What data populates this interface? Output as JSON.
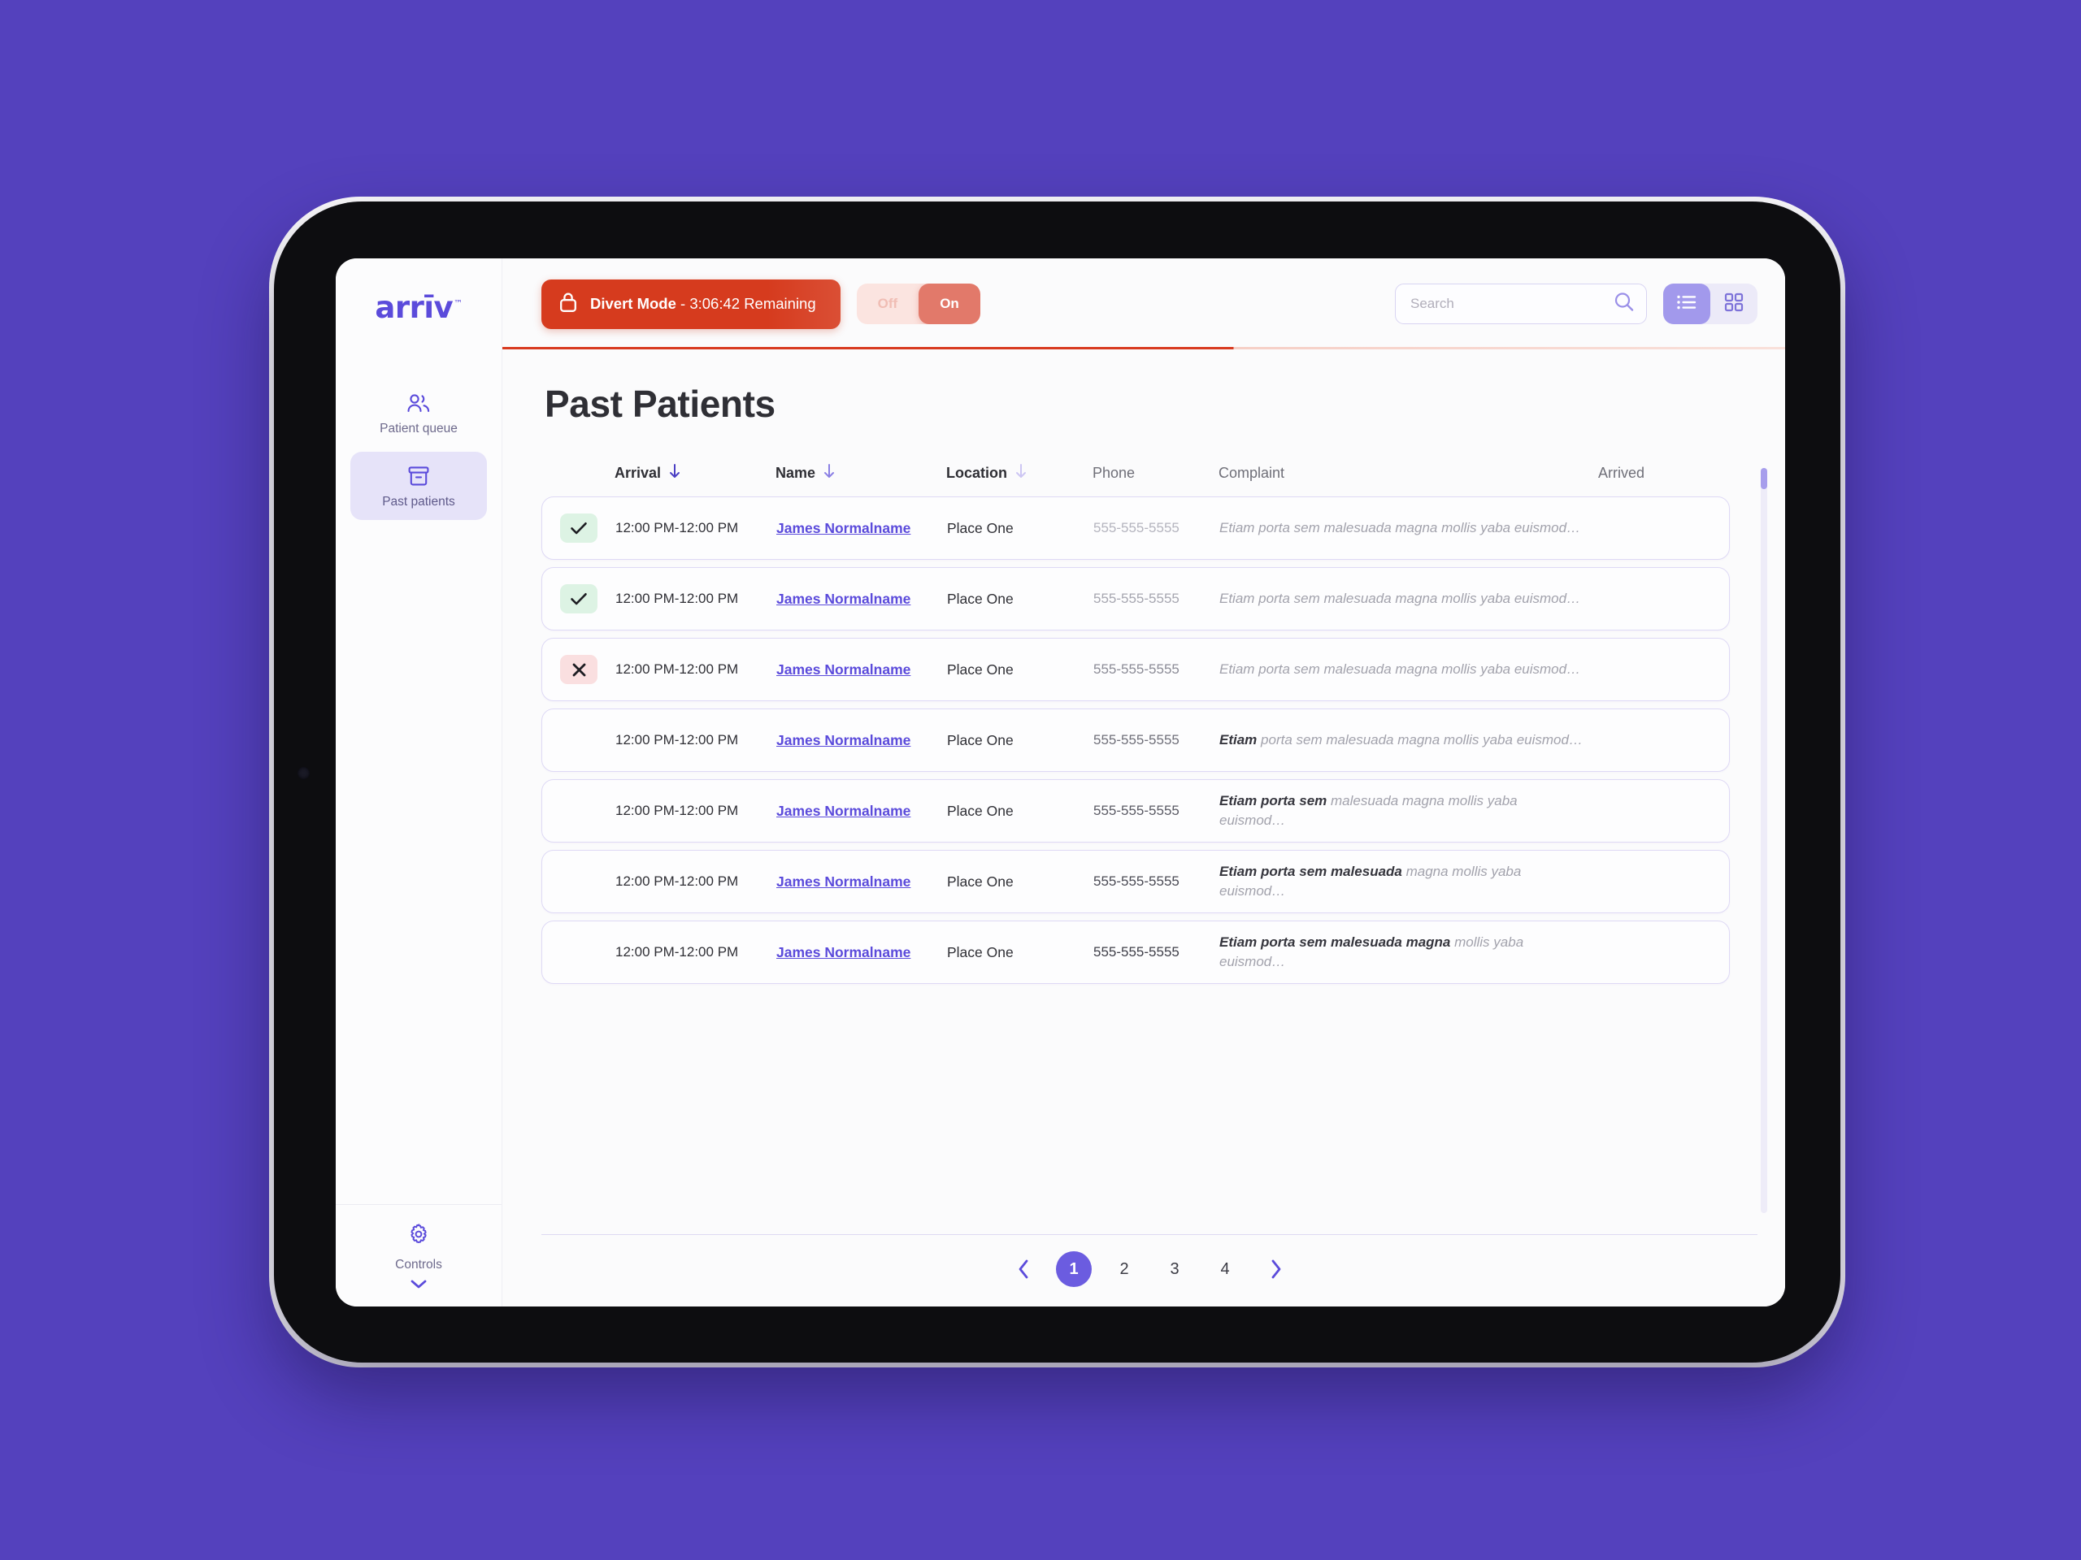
{
  "brand": {
    "name": "arrīv",
    "tm": "™"
  },
  "topbar": {
    "divert": {
      "label_strong": "Divert Mode",
      "label_rest": " - 3:06:42 Remaining",
      "icon": "lock-icon"
    },
    "toggle": {
      "off_label": "Off",
      "on_label": "On",
      "selected": "On"
    },
    "search": {
      "placeholder": "Search",
      "value": "",
      "icon": "search-icon"
    },
    "views": [
      {
        "name": "list-view",
        "icon": "list-icon",
        "active": true
      },
      {
        "name": "grid-view",
        "icon": "grid-icon",
        "active": false
      }
    ]
  },
  "sidebar": {
    "items": [
      {
        "label": "Patient queue",
        "icon": "users-icon",
        "active": false
      },
      {
        "label": "Past patients",
        "icon": "archive-icon",
        "active": true
      }
    ],
    "footer": {
      "label": "Controls",
      "icon": "gear-icon",
      "chevron": "chevron-down-icon"
    }
  },
  "page": {
    "title": "Past Patients"
  },
  "table": {
    "columns": [
      {
        "key": "status",
        "label": ""
      },
      {
        "key": "arrival",
        "label": "Arrival",
        "sort": "desc"
      },
      {
        "key": "name",
        "label": "Name",
        "sort": "desc"
      },
      {
        "key": "location",
        "label": "Location",
        "sort": "desc"
      },
      {
        "key": "phone",
        "label": "Phone"
      },
      {
        "key": "complaint",
        "label": "Complaint"
      },
      {
        "key": "arrived",
        "label": "Arrived"
      }
    ],
    "rows": [
      {
        "status": "check",
        "arrival": "12:00 PM-12:00 PM",
        "name": "James Normalname",
        "location": "Place One",
        "phone": "555-555-5555",
        "complaint_dark": "",
        "complaint_light": "Etiam porta sem malesuada magna mollis  yaba euismod…"
      },
      {
        "status": "check",
        "arrival": "12:00 PM-12:00 PM",
        "name": "James Normalname",
        "location": "Place One",
        "phone": "555-555-5555",
        "complaint_dark": "",
        "complaint_light": "Etiam porta sem malesuada magna mollis  yaba euismod…"
      },
      {
        "status": "cross",
        "arrival": "12:00 PM-12:00 PM",
        "name": "James Normalname",
        "location": "Place One",
        "phone": "555-555-5555",
        "complaint_dark": "",
        "complaint_light": "Etiam porta sem malesuada magna mollis  yaba euismod…"
      },
      {
        "status": "none",
        "arrival": "12:00 PM-12:00 PM",
        "name": "James Normalname",
        "location": "Place One",
        "phone": "555-555-5555",
        "complaint_dark": "Etiam ",
        "complaint_light": "porta sem malesuada magna mollis  yaba euismod…"
      },
      {
        "status": "none",
        "arrival": "12:00 PM-12:00 PM",
        "name": "James Normalname",
        "location": "Place One",
        "phone": "555-555-5555",
        "complaint_dark": "Etiam porta sem ",
        "complaint_light": "malesuada magna mollis  yaba euismod…"
      },
      {
        "status": "none",
        "arrival": "12:00 PM-12:00 PM",
        "name": "James Normalname",
        "location": "Place One",
        "phone": "555-555-5555",
        "complaint_dark": "Etiam porta sem malesuada ",
        "complaint_light": "magna mollis  yaba euismod…"
      },
      {
        "status": "none",
        "arrival": "12:00 PM-12:00 PM",
        "name": "James Normalname",
        "location": "Place One",
        "phone": "555-555-5555",
        "complaint_dark": "Etiam porta sem malesuada magna ",
        "complaint_light": "mollis  yaba euismod…"
      }
    ]
  },
  "pagination": {
    "prev": "‹",
    "next": "›",
    "pages": [
      "1",
      "2",
      "3",
      "4"
    ],
    "current": "1"
  },
  "colors": {
    "background": "#5441bd",
    "brand_purple": "#5b4bdb",
    "accent_purple": "#6b5ce0",
    "divert_red": "#d63b1e",
    "toggle_on": "#e2796a",
    "check_bg": "#ddf3e4",
    "cross_bg": "#fadfe0"
  }
}
